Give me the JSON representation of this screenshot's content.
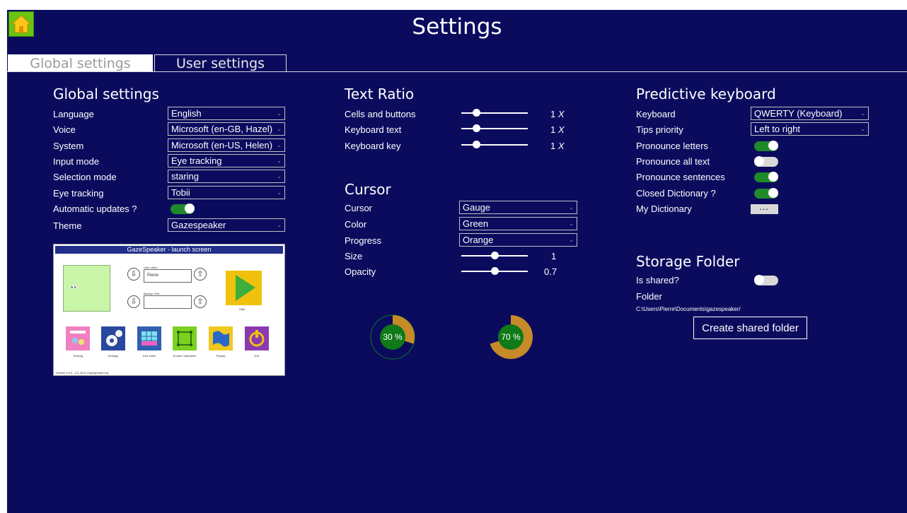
{
  "header": {
    "title": "Settings",
    "home_icon": "home-icon"
  },
  "tabs": [
    {
      "label": "Global settings",
      "active": true
    },
    {
      "label": "User settings",
      "active": false
    }
  ],
  "global": {
    "title": "Global settings",
    "rows": [
      {
        "label": "Language",
        "value": "English"
      },
      {
        "label": "Voice",
        "value": "Microsoft (en-GB, Hazel)"
      },
      {
        "label": "System",
        "value": "Microsoft (en-US, Helen)"
      },
      {
        "label": "Input mode",
        "value": "Eye tracking"
      },
      {
        "label": "Selection mode",
        "value": "staring"
      },
      {
        "label": "Eye tracking",
        "value": "Tobii"
      }
    ],
    "auto_updates_label": "Automatic updates ?",
    "auto_updates_on": true,
    "theme_label": "Theme",
    "theme_value": "Gazespeaker"
  },
  "preview": {
    "title": "GazeSpeaker - launch screen",
    "user_name_label": "User name",
    "user_name": "Pierre",
    "backup_label": "Backup Grid",
    "start_label": "Start",
    "apps": [
      {
        "label": "Training",
        "icon": "training-icon"
      },
      {
        "label": "Settings",
        "icon": "gear-icon"
      },
      {
        "label": "Grid editor",
        "icon": "grid-icon"
      },
      {
        "label": "Double Calibration",
        "icon": "calibration-icon"
      },
      {
        "label": "Replay",
        "icon": "flag-icon"
      },
      {
        "label": "Exit",
        "icon": "power-icon"
      }
    ],
    "version": "Version 0.9.5 - (C) 2014 Gazespeaker.org"
  },
  "text_ratio": {
    "title": "Text Ratio",
    "rows": [
      {
        "label": "Cells and buttons",
        "value": "1",
        "unit": "X",
        "fraction": 0.22
      },
      {
        "label": "Keyboard text",
        "value": "1",
        "unit": "X",
        "fraction": 0.22
      },
      {
        "label": "Keyboard key",
        "value": "1",
        "unit": "X",
        "fraction": 0.22
      }
    ]
  },
  "cursor": {
    "title": "Cursor",
    "selects": [
      {
        "label": "Cursor",
        "value": "Gauge"
      },
      {
        "label": "Color",
        "value": "Green"
      },
      {
        "label": "Progress",
        "value": "Orange"
      }
    ],
    "sliders": [
      {
        "label": "Size",
        "value": "1",
        "fraction": 0.5
      },
      {
        "label": "Opacity",
        "value": "0.7",
        "fraction": 0.5
      }
    ],
    "gauges": [
      {
        "label": "30 %",
        "progress": 0.3,
        "style": "ring"
      },
      {
        "label": "70 %",
        "progress": 0.7,
        "style": "pie"
      }
    ],
    "colors": {
      "gauge_green": "#0f7a17",
      "gauge_orange": "#c68a28"
    }
  },
  "predictive": {
    "title": "Predictive keyboard",
    "selects": [
      {
        "label": "Keyboard",
        "value": "QWERTY (Keyboard)"
      },
      {
        "label": "Tips priority",
        "value": "Left to right"
      }
    ],
    "toggles": [
      {
        "label": "Pronounce letters",
        "on": true
      },
      {
        "label": "Pronounce all text",
        "on": false
      },
      {
        "label": "Pronounce sentences",
        "on": true
      },
      {
        "label": "Closed Dictionary ?",
        "on": true
      }
    ],
    "dictionary_label": "My Dictionary",
    "dictionary_button": "..."
  },
  "storage": {
    "title": "Storage Folder",
    "shared_label": "Is shared?",
    "shared_on": false,
    "folder_label": "Folder",
    "folder_path": "C:\\Users\\Pierre\\Documents\\gazespeaker/",
    "create_button": "Create shared folder"
  },
  "colors": {
    "background": "#0b0b5e",
    "toggle_on": "#1f8a2a",
    "home": "#69c414"
  }
}
